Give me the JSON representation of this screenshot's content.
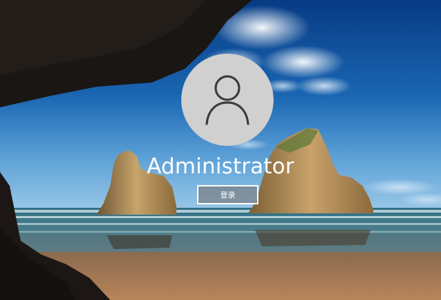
{
  "login": {
    "user_icon": "user-icon",
    "username": "Administrator",
    "signin_label": "登录"
  },
  "wallpaper": {
    "scene": "beach-cave-icon"
  },
  "colors": {
    "avatar_bg": "#d0d0d0",
    "avatar_glyph": "#3c3c3c",
    "button_border": "#ffffff",
    "button_fill": "#7a7a7a",
    "text": "#ffffff"
  }
}
